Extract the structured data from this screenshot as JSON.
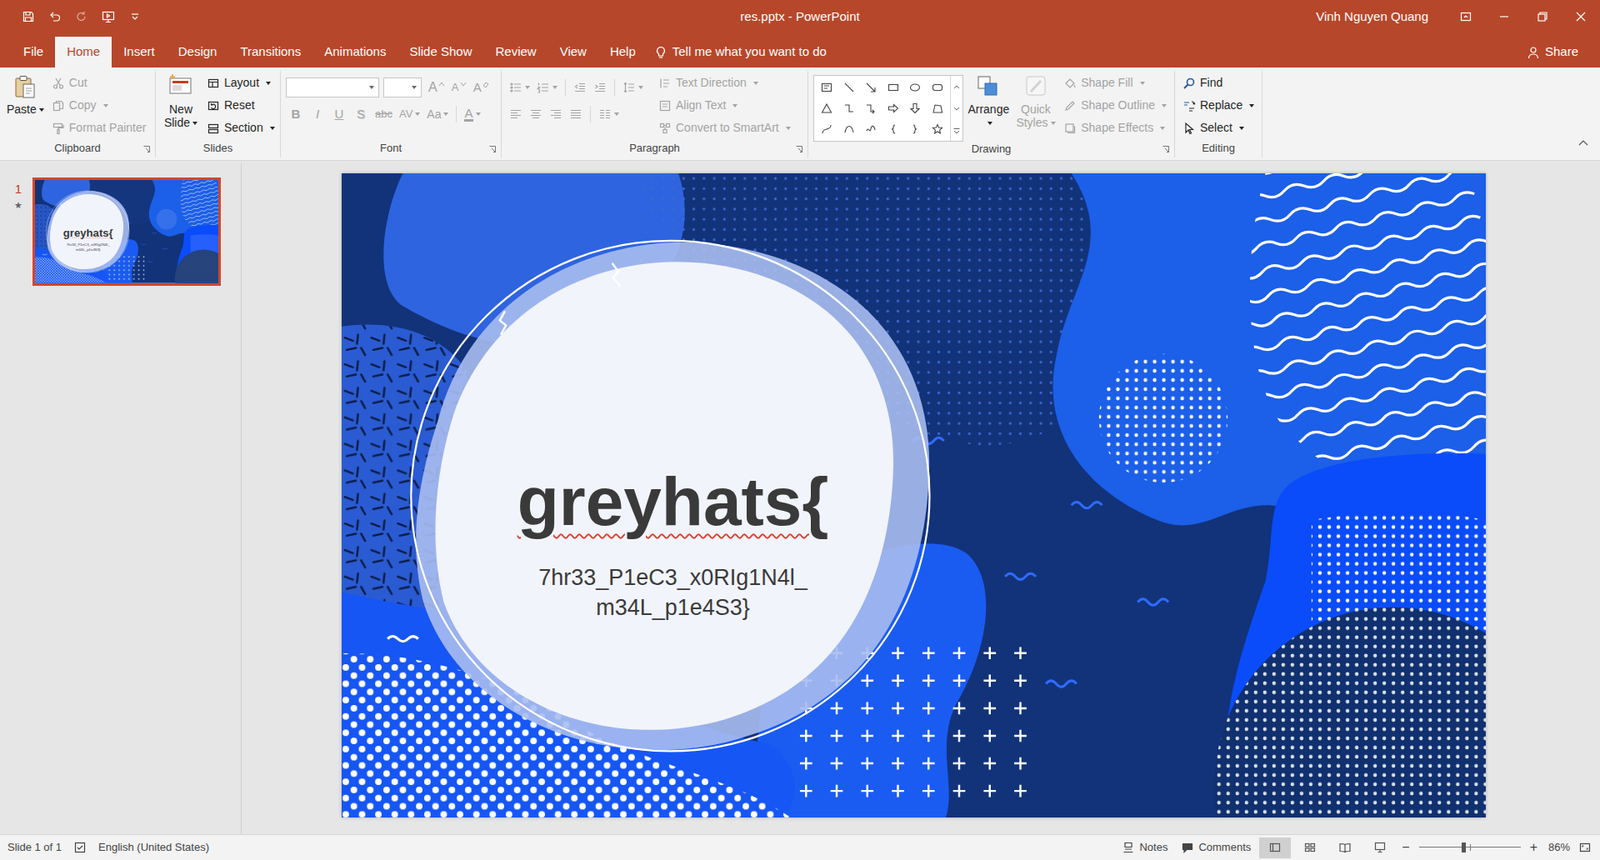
{
  "window": {
    "title": "res.pptx - PowerPoint",
    "user": "Vinh Nguyen Quang"
  },
  "menu": {
    "tabs": [
      {
        "label": "File",
        "selected": false
      },
      {
        "label": "Home",
        "selected": true
      },
      {
        "label": "Insert",
        "selected": false
      },
      {
        "label": "Design",
        "selected": false
      },
      {
        "label": "Transitions",
        "selected": false
      },
      {
        "label": "Animations",
        "selected": false
      },
      {
        "label": "Slide Show",
        "selected": false
      },
      {
        "label": "Review",
        "selected": false
      },
      {
        "label": "View",
        "selected": false
      },
      {
        "label": "Help",
        "selected": false
      }
    ],
    "tell_me": "Tell me what you want to do",
    "share": "Share"
  },
  "ribbon": {
    "clipboard": {
      "label": "Clipboard",
      "paste": {
        "label": "Paste",
        "disabled": false
      },
      "items": [
        {
          "label": "Cut",
          "kind": "cut",
          "disabled": true
        },
        {
          "label": "Copy",
          "kind": "copy",
          "disabled": true
        },
        {
          "label": "Format Painter",
          "kind": "painter",
          "disabled": true
        }
      ]
    },
    "slides": {
      "label": "Slides",
      "new_slide": {
        "label": "New Slide"
      },
      "items": [
        {
          "label": "Layout",
          "kind": "layout",
          "disabled": false
        },
        {
          "label": "Reset",
          "kind": "reset",
          "disabled": false
        },
        {
          "label": "Section",
          "kind": "section",
          "disabled": false
        }
      ]
    },
    "font": {
      "label": "Font",
      "disabled": true,
      "tools": [
        {
          "label": "A",
          "kind": "grow"
        },
        {
          "label": "A",
          "kind": "shrink"
        },
        {
          "label": "A",
          "kind": "clear"
        }
      ],
      "buttons": [
        {
          "label": "B",
          "kind": "bold"
        },
        {
          "label": "I",
          "kind": "italic"
        },
        {
          "label": "U",
          "kind": "underline"
        },
        {
          "label": "S",
          "kind": "shadow"
        },
        {
          "label": "abc",
          "kind": "strike"
        },
        {
          "label": "AV",
          "kind": "spacing"
        },
        {
          "label": "Aa",
          "kind": "case"
        },
        {
          "label": "A",
          "kind": "color"
        }
      ]
    },
    "paragraph": {
      "label": "Paragraph",
      "disabled": true,
      "items": [
        {
          "label": "Text Direction",
          "kind": "textdir",
          "disabled": true
        },
        {
          "label": "Align Text",
          "kind": "aligntext",
          "disabled": true
        },
        {
          "label": "Convert to SmartArt",
          "kind": "smartart",
          "disabled": true
        }
      ]
    },
    "drawing": {
      "label": "Drawing",
      "arrange": {
        "label": "Arrange"
      },
      "quick_styles": {
        "label": "Quick Styles",
        "disabled": true
      },
      "items": [
        {
          "label": "Shape Fill",
          "kind": "fill",
          "disabled": true
        },
        {
          "label": "Shape Outline",
          "kind": "outline",
          "disabled": true
        },
        {
          "label": "Shape Effects",
          "kind": "effects",
          "disabled": true
        }
      ]
    },
    "editing": {
      "label": "Editing",
      "items": [
        {
          "label": "Find",
          "kind": "find",
          "disabled": false
        },
        {
          "label": "Replace",
          "kind": "replace",
          "disabled": false
        },
        {
          "label": "Select",
          "kind": "select",
          "disabled": false
        }
      ]
    }
  },
  "slides": [
    {
      "number": "1",
      "selected": true,
      "mark": "★"
    }
  ],
  "slide": {
    "title": "greyhats{",
    "misspelled": true,
    "lines": [
      "7hr33_P1eC3_x0RIg1N4l_",
      "m34L_p1e4S3}"
    ]
  },
  "status": {
    "slide": "Slide 1 of 1",
    "language": "English (United States)",
    "notes": "Notes",
    "comments": "Comments",
    "views": [
      {
        "kind": "normal",
        "selected": true
      },
      {
        "kind": "sorter",
        "selected": false
      },
      {
        "kind": "reading",
        "selected": false
      },
      {
        "kind": "show",
        "selected": false
      }
    ],
    "zoom_out": "−",
    "zoom_in": "+",
    "zoom": "86%",
    "zoom_level": 0.44
  }
}
